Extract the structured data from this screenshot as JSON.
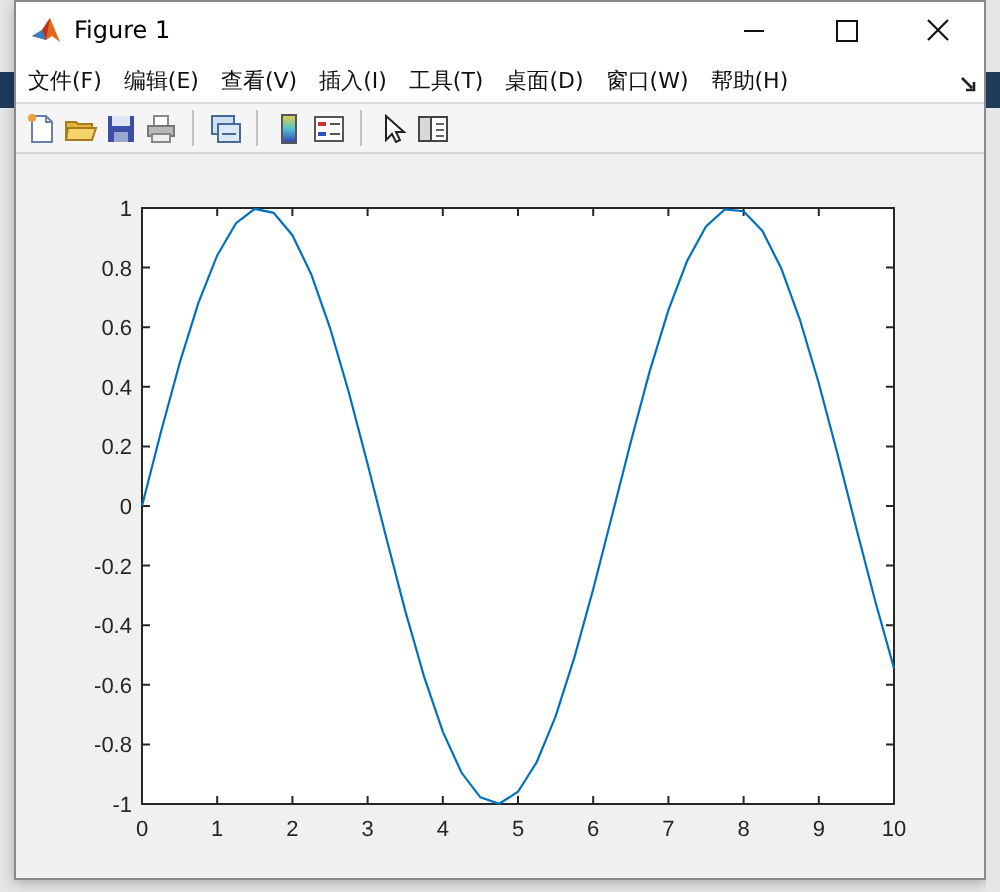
{
  "window": {
    "title": "Figure 1"
  },
  "menu": [
    "文件(F)",
    "编辑(E)",
    "查看(V)",
    "插入(I)",
    "工具(T)",
    "桌面(D)",
    "窗口(W)",
    "帮助(H)"
  ],
  "toolbar": [
    {
      "kind": "new"
    },
    {
      "kind": "open"
    },
    {
      "kind": "save"
    },
    {
      "kind": "print"
    },
    {
      "kind": "separator"
    },
    {
      "kind": "link"
    },
    {
      "kind": "separator"
    },
    {
      "kind": "colorbar"
    },
    {
      "kind": "legend"
    },
    {
      "kind": "separator"
    },
    {
      "kind": "pointer"
    },
    {
      "kind": "panel"
    }
  ],
  "plot": {
    "chart_data": {
      "type": "line",
      "x": [
        0,
        0.25,
        0.5,
        0.75,
        1,
        1.25,
        1.5,
        1.75,
        2,
        2.25,
        2.5,
        2.75,
        3,
        3.25,
        3.5,
        3.75,
        4,
        4.25,
        4.5,
        4.75,
        5,
        5.25,
        5.5,
        5.75,
        6,
        6.25,
        6.5,
        6.75,
        7,
        7.25,
        7.5,
        7.75,
        8,
        8.25,
        8.5,
        8.75,
        9,
        9.25,
        9.5,
        9.75,
        10
      ],
      "series": [
        {
          "color": "#0072bd",
          "values": [
            0,
            0.247,
            0.479,
            0.682,
            0.841,
            0.949,
            0.997,
            0.984,
            0.909,
            0.778,
            0.598,
            0.382,
            0.141,
            -0.108,
            -0.351,
            -0.572,
            -0.757,
            -0.895,
            -0.978,
            -0.999,
            -0.959,
            -0.859,
            -0.706,
            -0.508,
            -0.279,
            -0.033,
            0.215,
            0.451,
            0.657,
            0.823,
            0.938,
            0.995,
            0.989,
            0.923,
            0.798,
            0.624,
            0.412,
            0.174,
            -0.075,
            -0.319,
            -0.544
          ]
        }
      ],
      "xlim": [
        0,
        10
      ],
      "ylim": [
        -1,
        1
      ],
      "xticks": [
        0,
        1,
        2,
        3,
        4,
        5,
        6,
        7,
        8,
        9,
        10
      ],
      "yticks": [
        -1,
        -0.8,
        -0.6,
        -0.4,
        -0.2,
        0,
        0.2,
        0.4,
        0.6,
        0.8,
        1
      ]
    }
  }
}
